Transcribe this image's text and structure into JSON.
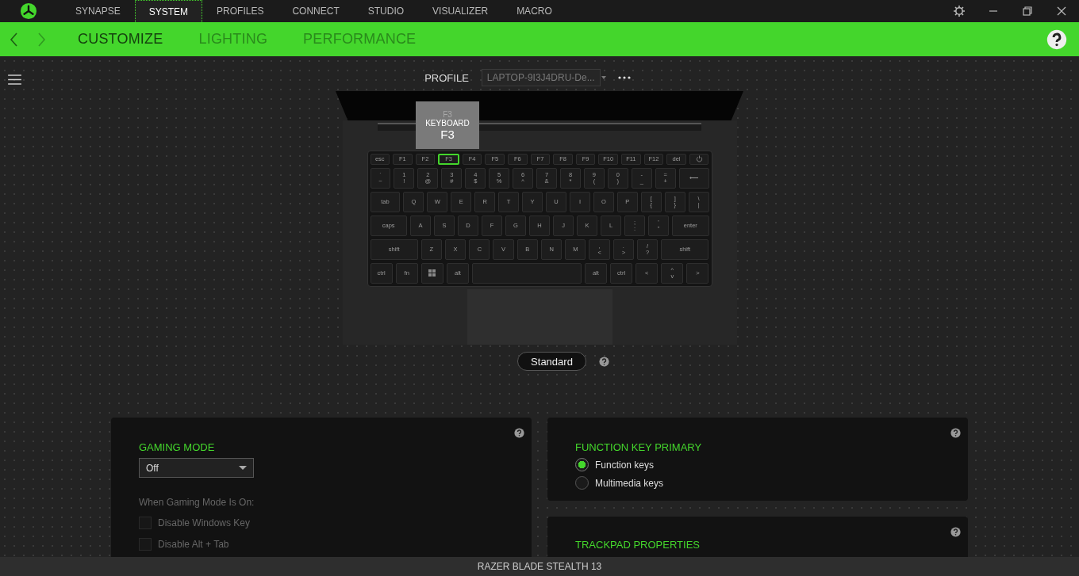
{
  "window": {
    "tabs": [
      {
        "label": "SYNAPSE",
        "selected": false
      },
      {
        "label": "SYSTEM",
        "selected": true
      },
      {
        "label": "PROFILES",
        "selected": false
      },
      {
        "label": "CONNECT",
        "selected": false
      },
      {
        "label": "STUDIO",
        "selected": false
      },
      {
        "label": "VISUALIZER",
        "selected": false
      },
      {
        "label": "MACRO",
        "selected": false
      }
    ]
  },
  "nav": {
    "back_disabled": false,
    "forward_disabled": true
  },
  "subtabs": [
    {
      "label": "CUSTOMIZE",
      "selected": true
    },
    {
      "label": "LIGHTING",
      "selected": false
    },
    {
      "label": "PERFORMANCE",
      "selected": false
    }
  ],
  "profile": {
    "label": "PROFILE",
    "value": "LAPTOP-9I3J4DRU-De..."
  },
  "tooltip": {
    "top": "F3",
    "middle": "KEYBOARD",
    "bottom": "F3"
  },
  "keyboard": [
    [
      {
        "kind": "key",
        "label": "esc",
        "selected": false
      },
      {
        "kind": "key",
        "label": "F1",
        "selected": false
      },
      {
        "kind": "key",
        "label": "F2",
        "selected": false
      },
      {
        "kind": "key",
        "label": "F3",
        "selected": true
      },
      {
        "kind": "key",
        "label": "F4",
        "selected": false
      },
      {
        "kind": "key",
        "label": "F5",
        "selected": false
      },
      {
        "kind": "key",
        "label": "F6",
        "selected": false
      },
      {
        "kind": "key",
        "label": "F7",
        "selected": false
      },
      {
        "kind": "key",
        "label": "F8",
        "selected": false
      },
      {
        "kind": "key",
        "label": "F9",
        "selected": false
      },
      {
        "kind": "key",
        "label": "F10",
        "selected": false
      },
      {
        "kind": "key",
        "label": "F11",
        "selected": false
      },
      {
        "kind": "key",
        "label": "F12",
        "selected": false
      },
      {
        "kind": "key",
        "label": "del",
        "selected": false
      },
      {
        "kind": "power",
        "selected": false
      }
    ],
    [
      {
        "kind": "key",
        "label": "`",
        "sub": "~",
        "selected": false
      },
      {
        "kind": "key",
        "label": "1",
        "sub": "!",
        "selected": false
      },
      {
        "kind": "key",
        "label": "2",
        "sub": "@",
        "selected": false
      },
      {
        "kind": "key",
        "label": "3",
        "sub": "#",
        "selected": false
      },
      {
        "kind": "key",
        "label": "4",
        "sub": "$",
        "selected": false
      },
      {
        "kind": "key",
        "label": "5",
        "sub": "%",
        "selected": false
      },
      {
        "kind": "key",
        "label": "6",
        "sub": "^",
        "selected": false
      },
      {
        "kind": "key",
        "label": "7",
        "sub": "&",
        "selected": false
      },
      {
        "kind": "key",
        "label": "8",
        "sub": "*",
        "selected": false
      },
      {
        "kind": "key",
        "label": "9",
        "sub": "(",
        "selected": false
      },
      {
        "kind": "key",
        "label": "0",
        "sub": ")",
        "selected": false
      },
      {
        "kind": "key",
        "label": "-",
        "sub": "_",
        "selected": false
      },
      {
        "kind": "key",
        "label": "=",
        "sub": "+",
        "selected": false
      },
      {
        "kind": "wide",
        "label": "⟵",
        "selected": false
      }
    ],
    [
      {
        "kind": "wide",
        "label": "tab",
        "selected": false
      },
      {
        "kind": "key",
        "label": "Q",
        "selected": false
      },
      {
        "kind": "key",
        "label": "W",
        "selected": false
      },
      {
        "kind": "key",
        "label": "E",
        "selected": false
      },
      {
        "kind": "key",
        "label": "R",
        "selected": false
      },
      {
        "kind": "key",
        "label": "T",
        "selected": false
      },
      {
        "kind": "key",
        "label": "Y",
        "selected": false
      },
      {
        "kind": "key",
        "label": "U",
        "selected": false
      },
      {
        "kind": "key",
        "label": "I",
        "selected": false
      },
      {
        "kind": "key",
        "label": "O",
        "selected": false
      },
      {
        "kind": "key",
        "label": "P",
        "selected": false
      },
      {
        "kind": "key",
        "label": "[",
        "sub": "{",
        "selected": false
      },
      {
        "kind": "key",
        "label": "]",
        "sub": "}",
        "selected": false
      },
      {
        "kind": "key",
        "label": "\\",
        "sub": "|",
        "selected": false
      }
    ],
    [
      {
        "kind": "xwide",
        "label": "caps",
        "selected": false
      },
      {
        "kind": "key",
        "label": "A",
        "selected": false
      },
      {
        "kind": "key",
        "label": "S",
        "selected": false
      },
      {
        "kind": "key",
        "label": "D",
        "selected": false
      },
      {
        "kind": "key",
        "label": "F",
        "selected": false
      },
      {
        "kind": "key",
        "label": "G",
        "selected": false
      },
      {
        "kind": "key",
        "label": "H",
        "selected": false
      },
      {
        "kind": "key",
        "label": "J",
        "selected": false
      },
      {
        "kind": "key",
        "label": "K",
        "selected": false
      },
      {
        "kind": "key",
        "label": "L",
        "selected": false
      },
      {
        "kind": "key",
        "label": ";",
        "sub": ":",
        "selected": false
      },
      {
        "kind": "key",
        "label": "'",
        "sub": "\"",
        "selected": false
      },
      {
        "kind": "xwide",
        "label": "enter",
        "selected": false
      }
    ],
    [
      {
        "kind": "xxwide",
        "label": "shift",
        "selected": false
      },
      {
        "kind": "key",
        "label": "Z",
        "selected": false
      },
      {
        "kind": "key",
        "label": "X",
        "selected": false
      },
      {
        "kind": "key",
        "label": "C",
        "selected": false
      },
      {
        "kind": "key",
        "label": "V",
        "selected": false
      },
      {
        "kind": "key",
        "label": "B",
        "selected": false
      },
      {
        "kind": "key",
        "label": "N",
        "selected": false
      },
      {
        "kind": "key",
        "label": "M",
        "selected": false
      },
      {
        "kind": "key",
        "label": ",",
        "sub": "<",
        "selected": false
      },
      {
        "kind": "key",
        "label": ".",
        "sub": ">",
        "selected": false
      },
      {
        "kind": "key",
        "label": "/",
        "sub": "?",
        "selected": false
      },
      {
        "kind": "xxwide",
        "label": "shift",
        "selected": false
      }
    ],
    [
      {
        "kind": "key",
        "label": "ctrl",
        "selected": false
      },
      {
        "kind": "key",
        "label": "fn",
        "selected": false
      },
      {
        "kind": "win",
        "selected": false
      },
      {
        "kind": "key",
        "label": "alt",
        "selected": false
      },
      {
        "kind": "space",
        "selected": false
      },
      {
        "kind": "key",
        "label": "alt",
        "selected": false
      },
      {
        "kind": "key",
        "label": "ctrl",
        "selected": false
      },
      {
        "kind": "key",
        "label": "<",
        "selected": false
      },
      {
        "kind": "key",
        "label": "^",
        "sub": "v",
        "selected": false
      },
      {
        "kind": "key",
        "label": ">",
        "selected": false
      }
    ]
  ],
  "mode_button": {
    "label": "Standard"
  },
  "gaming_mode": {
    "title": "GAMING MODE",
    "value": "Off",
    "caption": "When Gaming Mode Is On:",
    "options": [
      {
        "label": "Disable Windows Key",
        "checked": false,
        "disabled": true
      },
      {
        "label": "Disable Alt + Tab",
        "checked": false,
        "disabled": true
      }
    ]
  },
  "function_key_primary": {
    "title": "FUNCTION KEY PRIMARY",
    "options": [
      {
        "label": "Function keys",
        "selected": true
      },
      {
        "label": "Multimedia keys",
        "selected": false
      }
    ]
  },
  "trackpad": {
    "title": "TRACKPAD PROPERTIES"
  },
  "status_bar": {
    "device": "RAZER BLADE STEALTH 13"
  }
}
